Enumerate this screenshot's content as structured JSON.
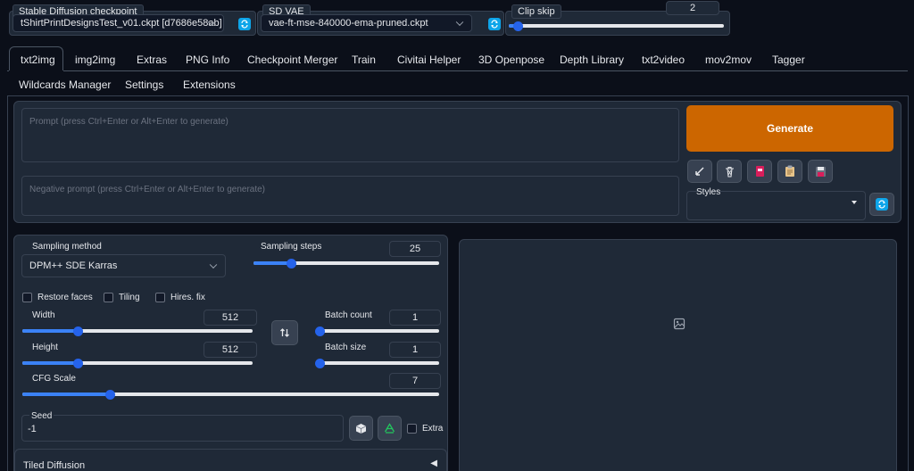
{
  "top": {
    "checkpoint": {
      "label": "Stable Diffusion checkpoint",
      "value": "tShirtPrintDesignsTest_v01.ckpt [d7686e58ab]"
    },
    "vae": {
      "label": "SD VAE",
      "value": "vae-ft-mse-840000-ema-pruned.ckpt"
    },
    "clip_skip": {
      "label": "Clip skip",
      "value": "2",
      "fraction": 0.04
    }
  },
  "tabs_row1": [
    "txt2img",
    "img2img",
    "Extras",
    "PNG Info",
    "Checkpoint Merger",
    "Train",
    "Civitai Helper",
    "3D Openpose",
    "Depth Library",
    "txt2video",
    "mov2mov",
    "Tagger"
  ],
  "tabs_row2": [
    "Wildcards Manager",
    "Settings",
    "Extensions"
  ],
  "prompt": {
    "placeholder": "Prompt (press Ctrl+Enter or Alt+Enter to generate)",
    "negative_placeholder": "Negative prompt (press Ctrl+Enter or Alt+Enter to generate)"
  },
  "generate": {
    "label": "Generate",
    "color": "#cc6600"
  },
  "tools": [
    "arrow-diagonal-icon",
    "trash-icon",
    "red-book-icon",
    "clipboard-icon",
    "floppy-disk-icon"
  ],
  "styles": {
    "label": "Styles",
    "value": ""
  },
  "sampling": {
    "method_label": "Sampling method",
    "method_value": "DPM++ SDE Karras",
    "steps_label": "Sampling steps",
    "steps_value": "25",
    "steps_fraction": 0.2
  },
  "checkboxes": {
    "restore_faces": "Restore faces",
    "tiling": "Tiling",
    "hires_fix": "Hires. fix",
    "extra": "Extra"
  },
  "width": {
    "label": "Width",
    "value": "512",
    "fraction": 0.24
  },
  "height": {
    "label": "Height",
    "value": "512",
    "fraction": 0.24
  },
  "batch_count": {
    "label": "Batch count",
    "value": "1",
    "fraction": 0.0
  },
  "batch_size": {
    "label": "Batch size",
    "value": "1",
    "fraction": 0.0
  },
  "cfg": {
    "label": "CFG Scale",
    "value": "7",
    "fraction": 0.21
  },
  "seed": {
    "label": "Seed",
    "value": "-1"
  },
  "tiled_diffusion": {
    "label": "Tiled Diffusion",
    "arrow": "◀"
  }
}
